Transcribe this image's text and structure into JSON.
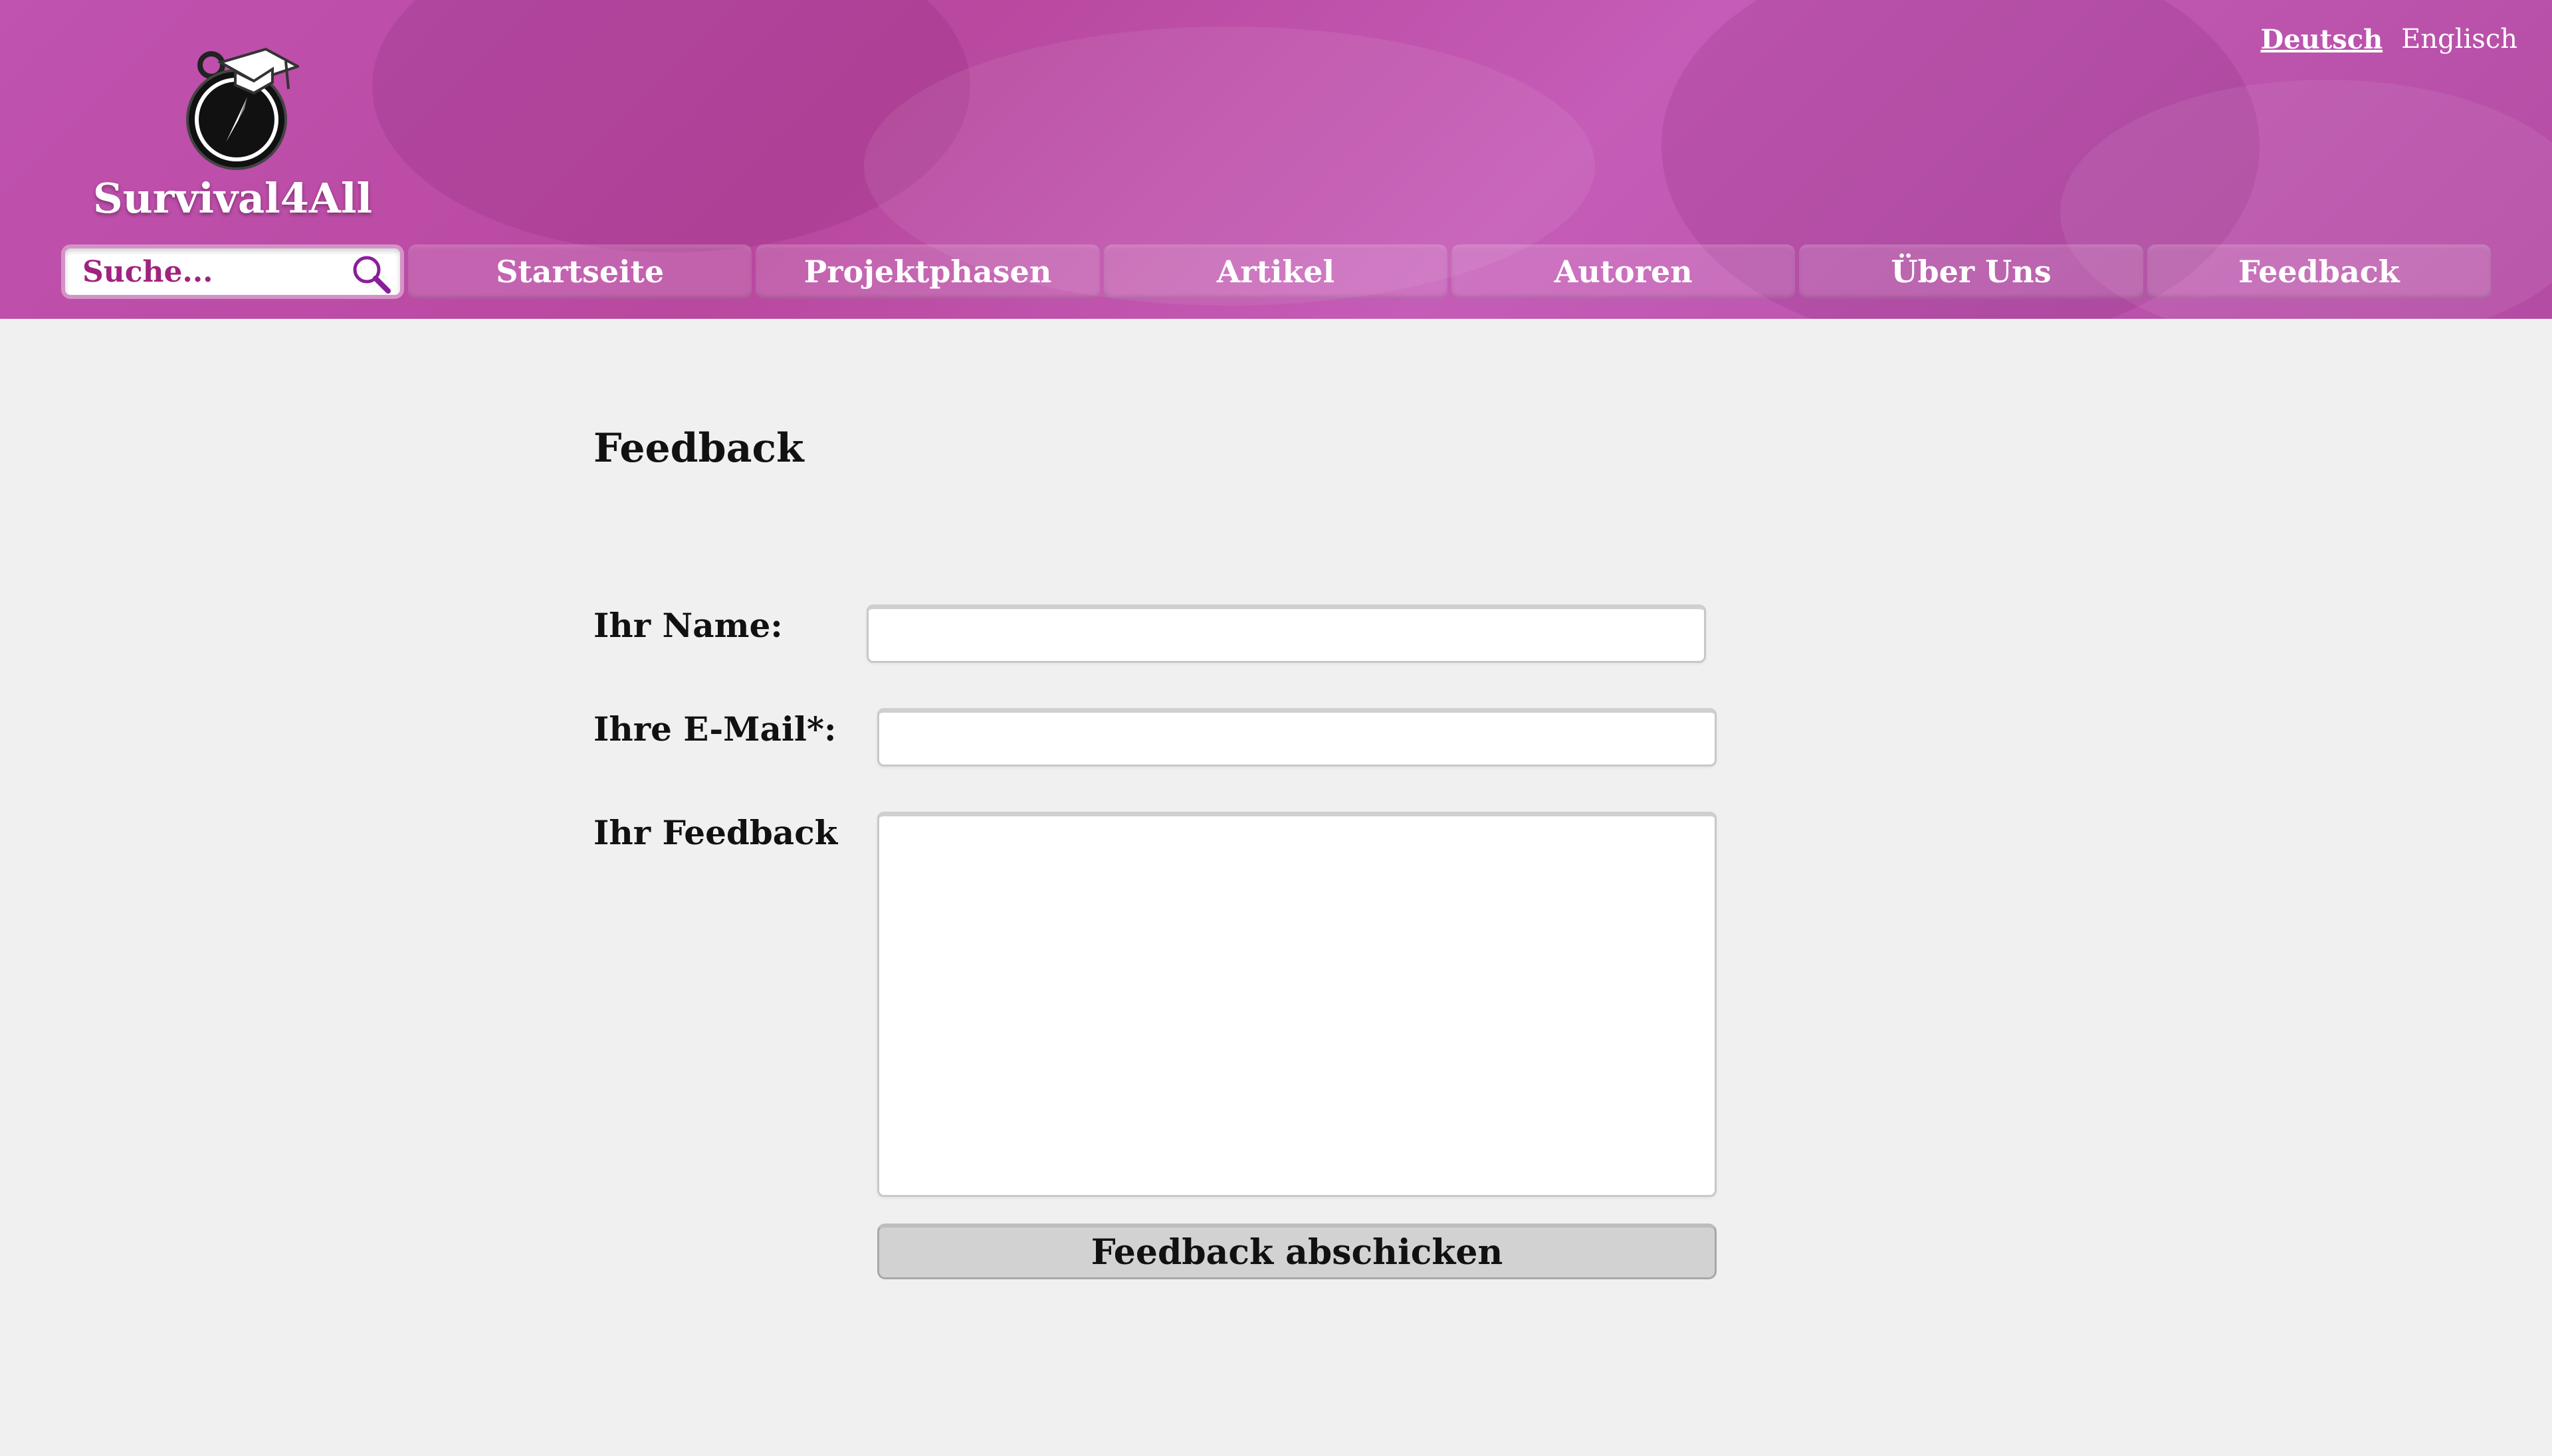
{
  "header": {
    "brand": "Survival4All",
    "languages": {
      "active": "Deutsch",
      "other": "Englisch"
    },
    "logo_icon": "compass-graduation-cap-icon",
    "search": {
      "placeholder": "Suche...",
      "icon": "search-icon"
    },
    "nav": [
      "Startseite",
      "Projektphasen",
      "Artikel",
      "Autoren",
      "Über Uns",
      "Feedback"
    ],
    "colors": {
      "banner": "#c052b0",
      "search_text": "#a0237f"
    }
  },
  "main": {
    "title": "Feedback",
    "form": {
      "name_label": "Ihr Name:",
      "name_value": "",
      "email_label": "Ihre E-Mail*:",
      "email_value": "",
      "feedback_label": "Ihr Feedback",
      "feedback_value": "",
      "submit_label": "Feedback abschicken"
    }
  }
}
